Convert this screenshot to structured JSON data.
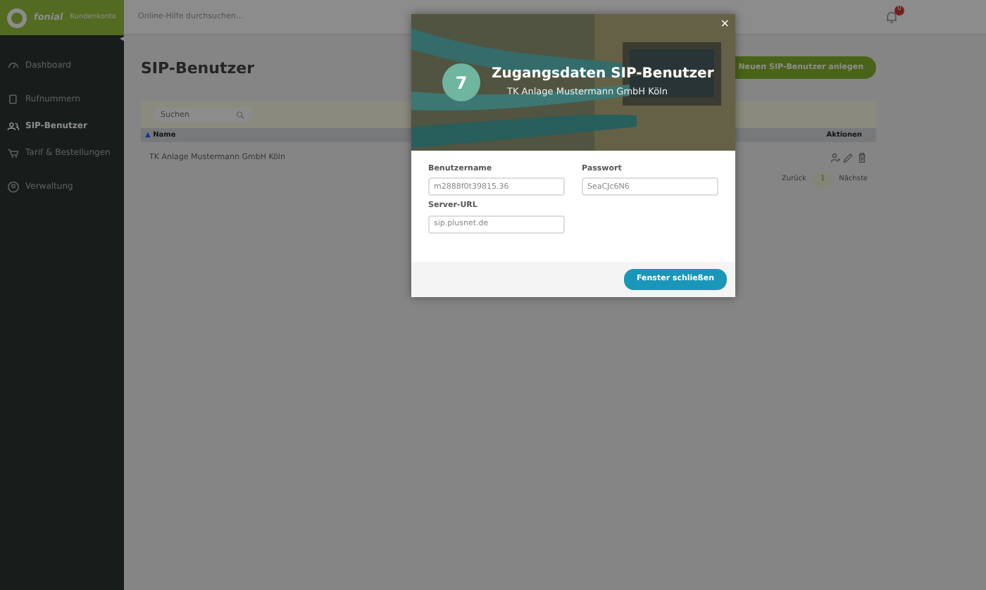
{
  "brand": {
    "logo_text": "fonial",
    "subtitle": "Kundenkonto"
  },
  "sidebar": {
    "collapse_glyph": "◂",
    "items": [
      {
        "label": "Dashboard",
        "selected": false
      },
      {
        "label": "Rufnummern",
        "selected": false
      },
      {
        "label": "SIP-Benutzer",
        "selected": true
      },
      {
        "label": "Tarif & Bestellungen",
        "selected": false
      },
      {
        "label": "Verwaltung",
        "selected": false
      }
    ]
  },
  "topbar": {
    "search_placeholder": "Online-Hilfe durchsuchen...",
    "notification_count": "0"
  },
  "page": {
    "title": "SIP-Benutzer",
    "primary_button": "Neuen SIP-Benutzer anlegen",
    "search_placeholder": "Suchen",
    "table": {
      "columns": [
        {
          "label": "Name",
          "sort_glyph": "▲"
        },
        {
          "label": "Aktionen"
        }
      ],
      "rows": [
        {
          "name": "TK Anlage Mustermann GmbH Köln"
        }
      ]
    },
    "pagination": {
      "prev": "Zurück",
      "current": "1",
      "next": "Nächste"
    }
  },
  "modal": {
    "number": "7",
    "title": "Zugangsdaten SIP-Benutzer",
    "subtitle": "TK Anlage Mustermann GmbH Köln",
    "close_glyph": "×",
    "fields": [
      {
        "label": "Benutzername",
        "value": "m2888f0t39815.36"
      },
      {
        "label": "Passwort",
        "value": "SeaCJc6N6"
      },
      {
        "label": "Server-URL",
        "value": "sip.plusnet.de"
      }
    ],
    "button": "Fenster schließen"
  }
}
